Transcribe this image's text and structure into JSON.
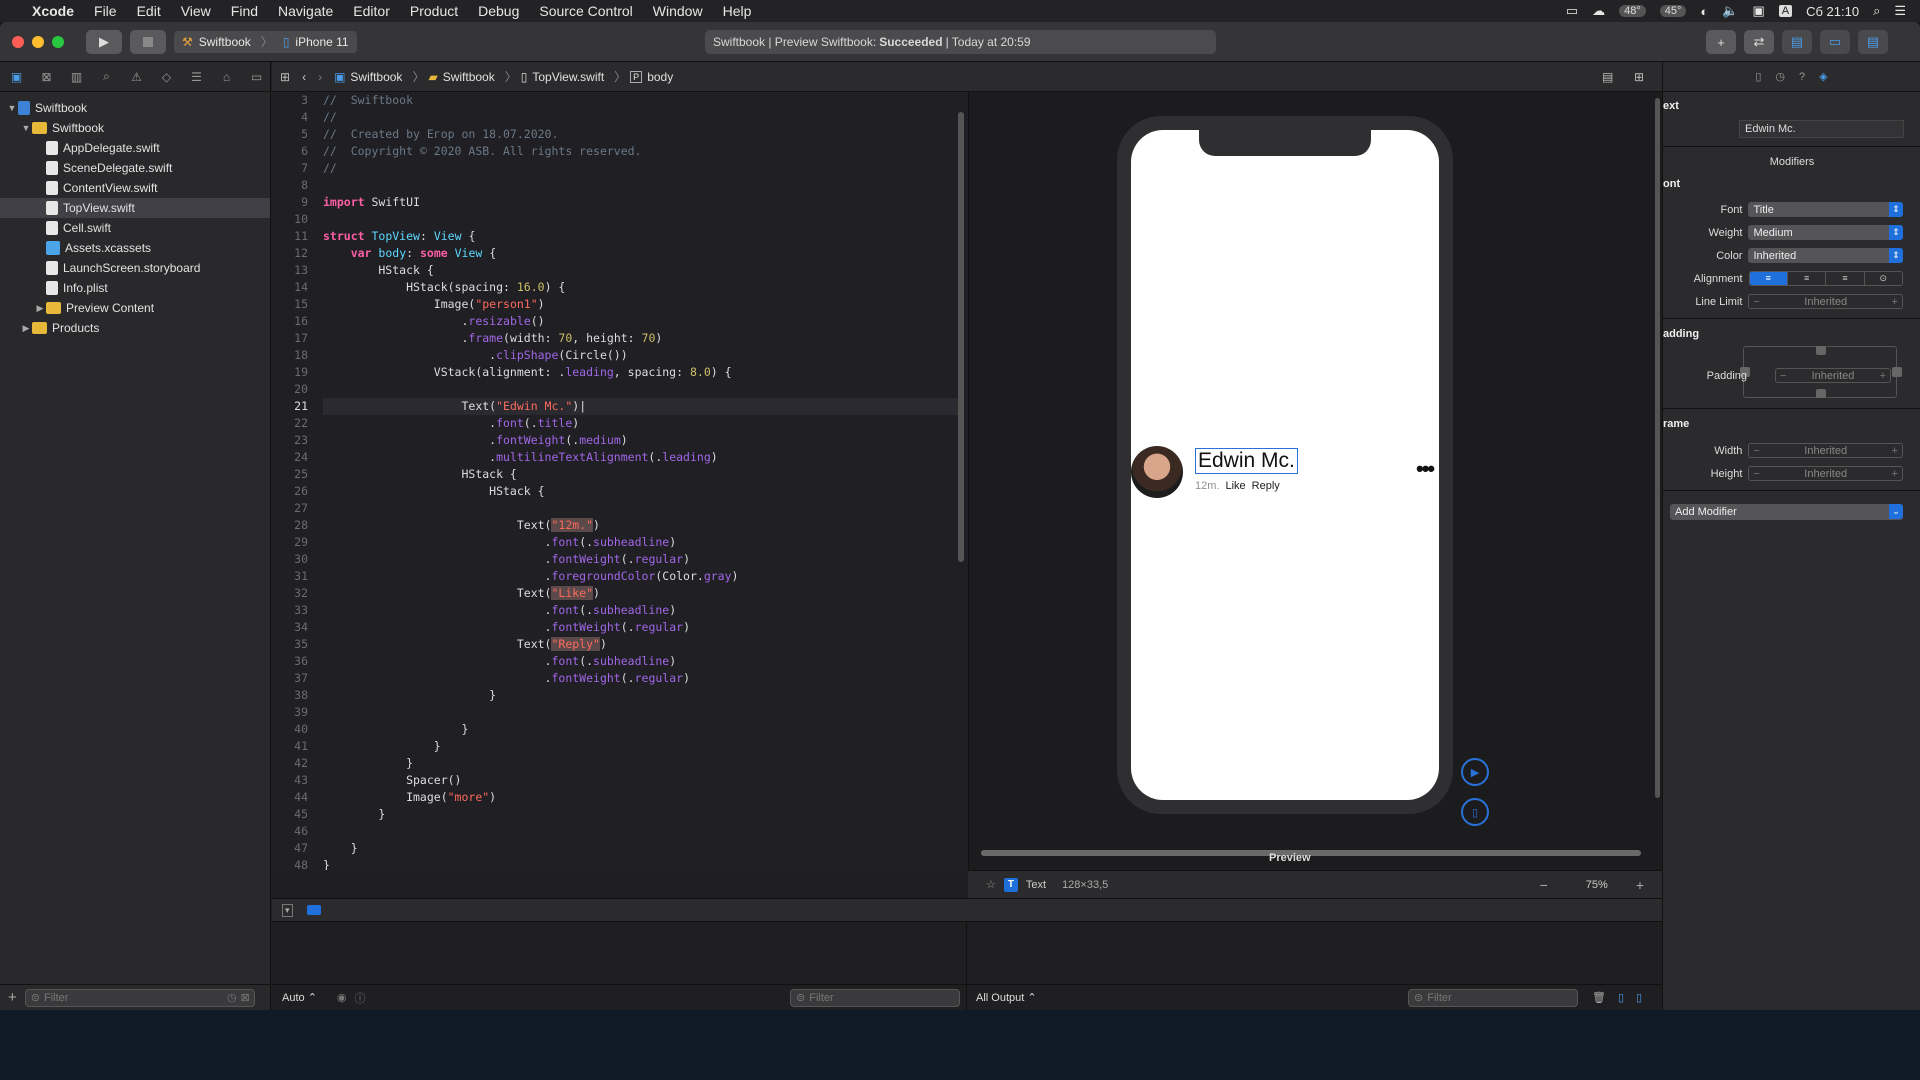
{
  "menubar": {
    "app": "Xcode",
    "items": [
      "File",
      "Edit",
      "View",
      "Find",
      "Navigate",
      "Editor",
      "Product",
      "Debug",
      "Source Control",
      "Window",
      "Help"
    ],
    "temp1": "48°",
    "temp2": "45°",
    "clock": "Сб 21:10",
    "input_lang": "A"
  },
  "toolbar": {
    "scheme": "Swiftbook",
    "device": "iPhone 11",
    "activity_prefix": "Swiftbook | Preview Swiftbook: ",
    "activity_status": "Succeeded",
    "activity_suffix": " | Today at 20:59"
  },
  "navigator": {
    "tree": [
      {
        "label": "Swiftbook",
        "icon": "project",
        "indent": 0,
        "disclosure": "▼",
        "selected": false
      },
      {
        "label": "Swiftbook",
        "icon": "folder",
        "indent": 1,
        "disclosure": "▼",
        "selected": false
      },
      {
        "label": "AppDelegate.swift",
        "icon": "swift",
        "indent": 2,
        "disclosure": "",
        "selected": false
      },
      {
        "label": "SceneDelegate.swift",
        "icon": "swift",
        "indent": 2,
        "disclosure": "",
        "selected": false
      },
      {
        "label": "ContentView.swift",
        "icon": "swift",
        "indent": 2,
        "disclosure": "",
        "selected": false
      },
      {
        "label": "TopView.swift",
        "icon": "swift",
        "indent": 2,
        "disclosure": "",
        "selected": true
      },
      {
        "label": "Cell.swift",
        "icon": "swift",
        "indent": 2,
        "disclosure": "",
        "selected": false
      },
      {
        "label": "Assets.xcassets",
        "icon": "assets",
        "indent": 2,
        "disclosure": "",
        "selected": false
      },
      {
        "label": "LaunchScreen.storyboard",
        "icon": "file",
        "indent": 2,
        "disclosure": "",
        "selected": false
      },
      {
        "label": "Info.plist",
        "icon": "file",
        "indent": 2,
        "disclosure": "",
        "selected": false
      },
      {
        "label": "Preview Content",
        "icon": "folder",
        "indent": 2,
        "disclosure": "▶",
        "selected": false
      },
      {
        "label": "Products",
        "icon": "folder",
        "indent": 1,
        "disclosure": "▶",
        "selected": false
      }
    ],
    "filter_placeholder": "Filter"
  },
  "jumpbar": {
    "crumbs": [
      "Swiftbook",
      "Swiftbook",
      "TopView.swift",
      "body"
    ]
  },
  "editor": {
    "current_line": 21,
    "first_line": 3,
    "lines": [
      "<span class='cm'>//  Swiftbook</span>",
      "<span class='cm'>//</span>",
      "<span class='cm'>//  Created by Егор on 18.07.2020.</span>",
      "<span class='cm'>//  Copyright © 2020 ASB. All rights reserved.</span>",
      "<span class='cm'>//</span>",
      "",
      "<span class='kw'>import</span> SwiftUI",
      "",
      "<span class='kw'>struct</span> <span class='ty'>TopView</span>: <span class='ty'>View</span> {",
      "    <span class='kw'>var</span> <span class='ty'>body</span>: <span class='kw'>some</span> <span class='ty'>View</span> {",
      "        HStack {",
      "            HStack(spacing: <span class='num'>16.0</span>) {",
      "                Image(<span class='str'>\"person1\"</span>)",
      "                    .<span class='mth'>resizable</span>()",
      "                    .<span class='mth'>frame</span>(width: <span class='num'>70</span>, height: <span class='num'>70</span>)",
      "                        .<span class='mth'>clipShape</span>(Circle())",
      "                VStack(alignment: .<span class='mth'>leading</span>, spacing: <span class='num'>8.0</span>) {",
      "",
      "                    Text(<span class='str'>\"Edwin Mc.\"</span>)|",
      "                        .<span class='mth'>font</span>(.<span class='mth'>title</span>)",
      "                        .<span class='mth'>fontWeight</span>(.<span class='mth'>medium</span>)",
      "                        .<span class='mth'>multilineTextAlignment</span>(.<span class='mth'>leading</span>)",
      "                    HStack {",
      "                        HStack {",
      "",
      "                            Text(<span class='str hl'>\"12m.\"</span>)",
      "                                .<span class='mth'>font</span>(.<span class='mth'>subheadline</span>)",
      "                                .<span class='mth'>fontWeight</span>(.<span class='mth'>regular</span>)",
      "                                .<span class='mth'>foregroundColor</span>(Color.<span class='mth'>gray</span>)",
      "                            Text(<span class='str hl'>\"Like\"</span>)",
      "                                .<span class='mth'>font</span>(.<span class='mth'>subheadline</span>)",
      "                                .<span class='mth'>fontWeight</span>(.<span class='mth'>regular</span>)",
      "                            Text(<span class='str hl'>\"Reply\"</span>)",
      "                                .<span class='mth'>font</span>(.<span class='mth'>subheadline</span>)",
      "                                .<span class='mth'>fontWeight</span>(.<span class='mth'>regular</span>)",
      "                        }",
      "",
      "                    }",
      "                }",
      "            }",
      "            Spacer()",
      "            Image(<span class='str'>\"more\"</span>)",
      "        }",
      "",
      "    }",
      "}"
    ]
  },
  "preview": {
    "name": "Edwin Mc.",
    "time": "12m.",
    "like": "Like",
    "reply": "Reply",
    "label": "Preview",
    "selection_type": "Text",
    "selection_size": "128×33,5",
    "zoom": "75%"
  },
  "inspector": {
    "section_text": "ext",
    "text_value": "Edwin Mc.",
    "modifiers_title": "Modifiers",
    "font_section": "ont",
    "font_label": "Font",
    "font_value": "Title",
    "weight_label": "Weight",
    "weight_value": "Medium",
    "color_label": "Color",
    "color_value": "Inherited",
    "alignment_label": "Alignment",
    "linelimit_label": "Line Limit",
    "inherited": "Inherited",
    "padding_section": "adding",
    "padding_label": "Padding",
    "frame_section": "rame",
    "width_label": "Width",
    "height_label": "Height",
    "add_modifier": "Add Modifier"
  },
  "debug": {
    "auto_label": "Auto",
    "filter_placeholder": "Filter",
    "output_label": "All Output"
  },
  "colors": {
    "accent": "#1f6fdc",
    "keyword": "#fc5fa3",
    "string": "#fc6a5d",
    "number": "#d0bf69"
  }
}
